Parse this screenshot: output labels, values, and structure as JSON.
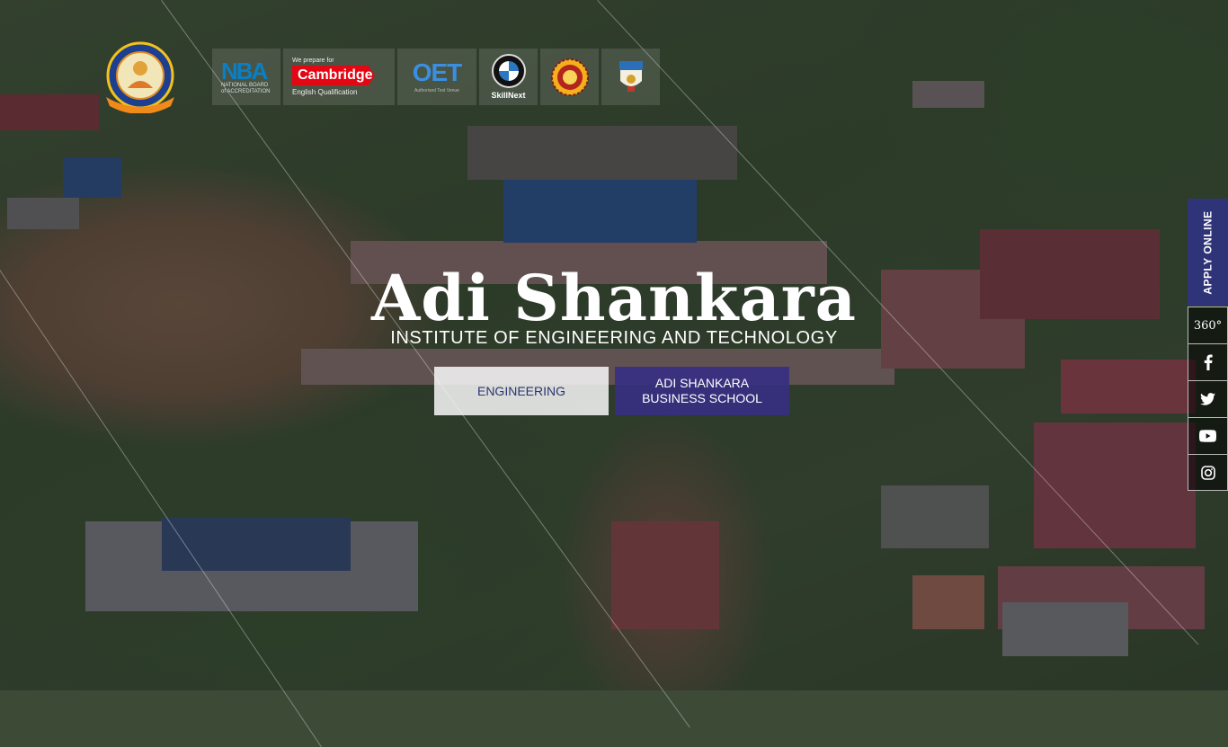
{
  "hero": {
    "title": "Adi Shankara",
    "subtitle": "INSTITUTE OF ENGINEERING AND TECHNOLOGY"
  },
  "buttons": {
    "engineering": "ENGINEERING",
    "business_school": "ADI SHANKARA BUSINESS SCHOOL"
  },
  "badges": {
    "nba": {
      "logo_text": "NBA",
      "caption": "NATIONAL BOARD of ACCREDITATION"
    },
    "cambridge": {
      "top": "We prepare for",
      "brand": "Cambridge",
      "caption": "English Qualification"
    },
    "oet": {
      "logo_text": "OET",
      "caption": "Authorised Test Venue"
    },
    "bmw": {
      "caption": "SkillNext"
    },
    "aicte": {
      "icon": "aicte-seal-icon"
    },
    "ktu": {
      "icon": "university-crest-icon"
    }
  },
  "sidebar": {
    "apply_label": "APPLY ONLINE",
    "tour_label": "360°",
    "social": [
      {
        "name": "facebook-icon"
      },
      {
        "name": "twitter-icon"
      },
      {
        "name": "youtube-icon"
      },
      {
        "name": "instagram-icon"
      }
    ]
  },
  "colors": {
    "brand": "#2f3478",
    "business_button": "#373082",
    "engineering_text": "#2d3473"
  }
}
